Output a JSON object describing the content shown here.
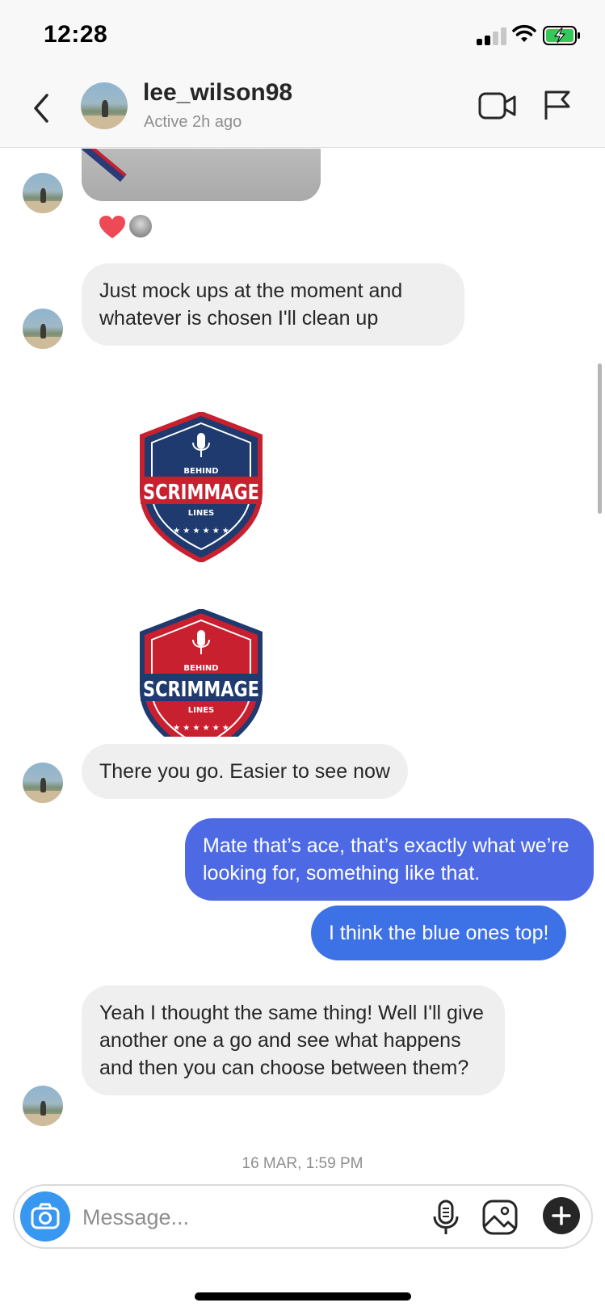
{
  "status_bar": {
    "time": "12:28"
  },
  "header": {
    "username": "lee_wilson98",
    "status": "Active 2h ago"
  },
  "messages": [
    {
      "from": "them",
      "text": "Just mock ups at the moment and whatever is chosen I'll clean up"
    },
    {
      "from": "them",
      "type": "image",
      "logo": {
        "top_text": "BEHIND",
        "main_text": "SCRIMMAGE",
        "bottom_text": "LINES",
        "color": "#1e3a6e"
      }
    },
    {
      "from": "them",
      "type": "image",
      "logo": {
        "top_text": "BEHIND",
        "main_text": "SCRIMMAGE",
        "bottom_text": "LINES",
        "color": "#c8202f"
      }
    },
    {
      "from": "them",
      "text": "There you go. Easier to see now"
    },
    {
      "from": "me",
      "text": "Mate that’s ace, that’s exactly what we’re looking for, something like that."
    },
    {
      "from": "me",
      "text": "I think the blue ones top!"
    },
    {
      "from": "them",
      "text": "Yeah I thought the same thing! Well I'll give another one a go and see what happens and then you can choose between them?"
    }
  ],
  "timestamp": "16 MAR, 1:59 PM",
  "composer": {
    "placeholder": "Message...",
    "icons": [
      "camera-icon",
      "microphone-icon",
      "gallery-icon",
      "plus-icon"
    ]
  },
  "colors": {
    "incoming_bubble": "#efefef",
    "outgoing_bubble": "#4d69e3",
    "outgoing_bubble_alt": "#3d72e6",
    "camera_button": "#3897f0",
    "heart": "#ed4956"
  }
}
